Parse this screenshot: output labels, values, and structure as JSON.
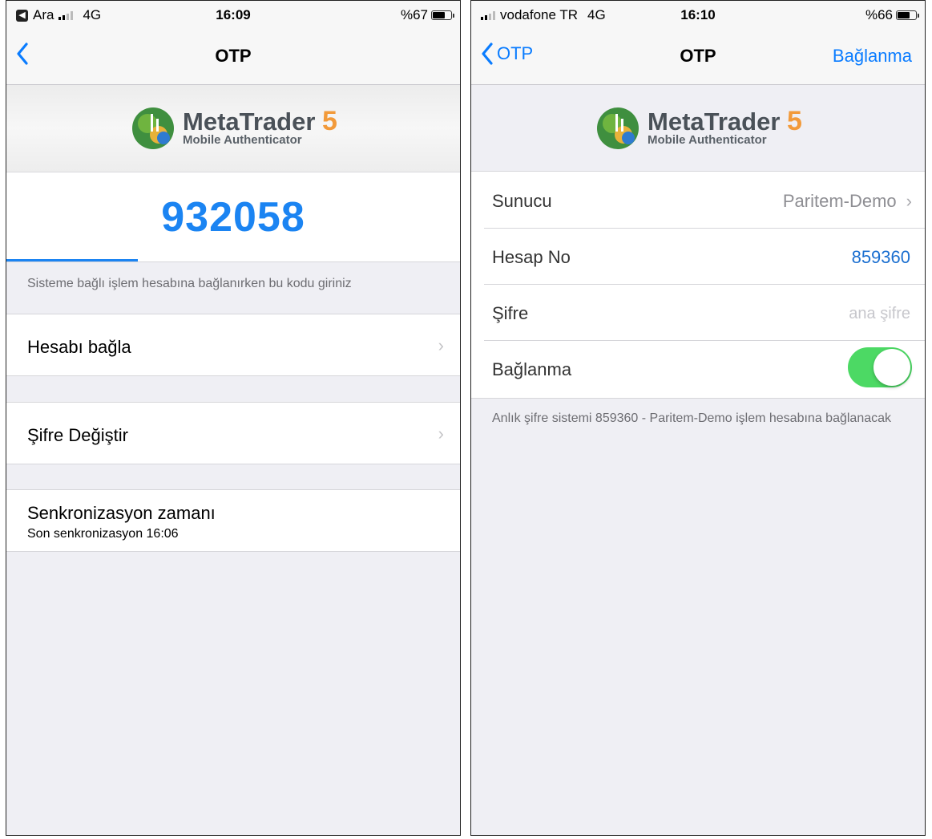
{
  "left": {
    "status": {
      "carrier": "Ara",
      "network": "4G",
      "time": "16:09",
      "battery": "%67",
      "battery_level": 0.67
    },
    "nav": {
      "title": "OTP"
    },
    "logo": {
      "brand": "MetaTrader",
      "version": "5",
      "subtitle": "Mobile Authenticator"
    },
    "otp": {
      "code": "932058",
      "hint": "Sisteme bağlı işlem hesabına bağlanırken bu kodu giriniz"
    },
    "rows": {
      "link_account": "Hesabı bağla",
      "change_password": "Şifre Değiştir",
      "sync_title": "Senkronizasyon zamanı",
      "sync_subtitle": "Son senkronizasyon 16:06"
    }
  },
  "right": {
    "status": {
      "carrier": "vodafone TR",
      "network": "4G",
      "time": "16:10",
      "battery": "%66",
      "battery_level": 0.66
    },
    "nav": {
      "back": "OTP",
      "title": "OTP",
      "action": "Bağlanma"
    },
    "logo": {
      "brand": "MetaTrader",
      "version": "5",
      "subtitle": "Mobile Authenticator"
    },
    "form": {
      "server_label": "Sunucu",
      "server_value": "Paritem-Demo",
      "account_label": "Hesap No",
      "account_value": "859360",
      "password_label": "Şifre",
      "password_placeholder": "ana şifre",
      "connect_label": "Bağlanma",
      "connect_on": true
    },
    "note": "Anlık şifre sistemi 859360 - Paritem-Demo işlem hesabına bağlanacak"
  },
  "colors": {
    "accent": "#1b84f2",
    "ios_blue": "#0a7cff",
    "toggle_on": "#4cd964",
    "logo_orange": "#f29a3a"
  }
}
